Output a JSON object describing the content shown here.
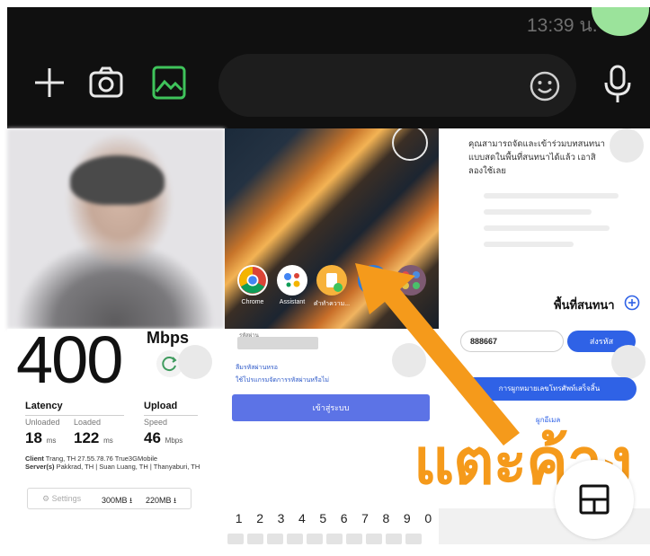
{
  "status_bar": {
    "time": "13:39 น."
  },
  "chat_bar": {
    "plus_icon": "plus-icon",
    "camera_icon": "camera-icon",
    "gallery_icon": "gallery-icon",
    "emoji_icon": "emoji-icon",
    "mic_icon": "mic-icon",
    "accent_color": "#3fc35b"
  },
  "home_screen": {
    "apps": [
      {
        "label": "Chrome",
        "color": "#ffffff"
      },
      {
        "label": "Assistant",
        "color": "#ffffff"
      },
      {
        "label": "คำทำความ...",
        "color": "#f7b23b"
      },
      {
        "label": "",
        "color": "#2d7bdb"
      },
      {
        "label": "",
        "color": "#c94b4b"
      }
    ]
  },
  "chat_app": {
    "message": "คุณสามารถจัดและเข้าร่วมบทสนทนาแบบสดในพื้นที่สนทนาได้แล้ว เอาสิ ลองใช้เลย",
    "space_label": "พื้นที่สนทนา"
  },
  "speedtest": {
    "value": "400",
    "unit": "Mbps",
    "latency_label": "Latency",
    "upload_label": "Upload",
    "unloaded_label": "Unloaded",
    "loaded_label": "Loaded",
    "speed_label": "Speed",
    "unloaded_value": "18",
    "loaded_value": "122",
    "upload_value": "46",
    "ms_unit": "ms",
    "mbps_unit": "Mbps",
    "client_label": "Client",
    "client_info": "Trang, TH  27.55.78.76  True3GMobile",
    "server_label": "Server(s)",
    "server_info": "Pakkrad, TH | Suan Luang, TH | Thanyaburi, TH",
    "settings_label": "⚙ Settings",
    "down_data": "300MB ⭳",
    "up_data": "220MB ⭳"
  },
  "login_form": {
    "field_label": "รหัสผ่าน",
    "forgot_link": "ลืมรหัสผ่านหรอ",
    "help_link": "ใช้โปรแกรมจัดการรหัสผ่านหรือไม่",
    "submit_label": "เข้าสู่ระบบ",
    "digits": [
      "1",
      "2",
      "3",
      "4",
      "5",
      "6",
      "7",
      "8",
      "9",
      "0"
    ]
  },
  "otp_form": {
    "code_value": "888667",
    "send_label": "ส่งรหัส",
    "bind_label": "การผูกหมายเลขโทรศัพท์เสร็จสิ้น",
    "help_label": "ผูกอีเมล"
  },
  "annotation": {
    "caption": "แตะค้าง",
    "arrow_color": "#f59a1b",
    "split_icon": "split-screen-icon"
  }
}
